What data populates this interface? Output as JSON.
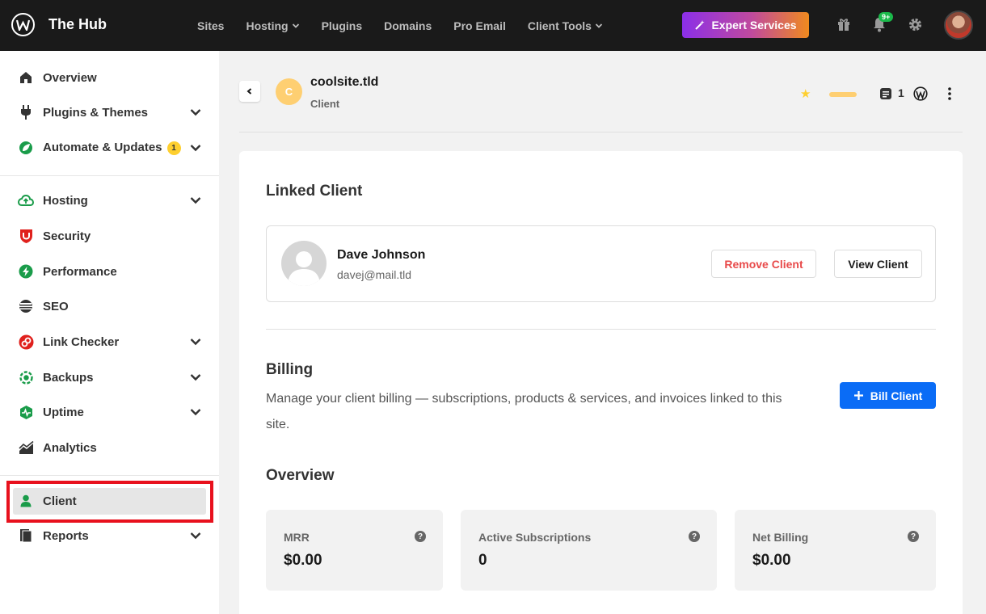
{
  "header": {
    "brand": "The Hub",
    "nav": [
      {
        "label": "Sites",
        "has_dropdown": false
      },
      {
        "label": "Hosting",
        "has_dropdown": true
      },
      {
        "label": "Plugins",
        "has_dropdown": false
      },
      {
        "label": "Domains",
        "has_dropdown": false
      },
      {
        "label": "Pro Email",
        "has_dropdown": false
      },
      {
        "label": "Client Tools",
        "has_dropdown": true
      }
    ],
    "expert_label": "Expert Services",
    "notification_badge": "9+"
  },
  "sidebar": {
    "group1": [
      {
        "label": "Overview",
        "icon": "home-icon"
      },
      {
        "label": "Plugins & Themes",
        "icon": "plug-icon"
      },
      {
        "label": "Automate & Updates",
        "icon": "automate-icon",
        "badge": "1"
      }
    ],
    "group2": [
      {
        "label": "Hosting",
        "icon": "cloud-icon"
      },
      {
        "label": "Security",
        "icon": "shield-icon"
      },
      {
        "label": "Performance",
        "icon": "bolt-icon"
      },
      {
        "label": "SEO",
        "icon": "seo-icon"
      },
      {
        "label": "Link Checker",
        "icon": "link-icon"
      },
      {
        "label": "Backups",
        "icon": "backup-icon"
      },
      {
        "label": "Uptime",
        "icon": "uptime-icon"
      },
      {
        "label": "Analytics",
        "icon": "analytics-icon"
      }
    ],
    "group3": [
      {
        "label": "Client",
        "icon": "user-icon"
      },
      {
        "label": "Reports",
        "icon": "report-icon"
      }
    ]
  },
  "site": {
    "initial": "C",
    "name": "coolsite.tld",
    "subtitle": "Client",
    "post_count": "1"
  },
  "linked_client": {
    "heading": "Linked Client",
    "name": "Dave Johnson",
    "email": "davej@mail.tld",
    "remove_label": "Remove Client",
    "view_label": "View Client"
  },
  "billing": {
    "heading": "Billing",
    "description": "Manage your client billing — subscriptions, products & services, and invoices linked to this site.",
    "bill_label": "Bill Client"
  },
  "overview": {
    "heading": "Overview",
    "stats": [
      {
        "label": "MRR",
        "value": "$0.00"
      },
      {
        "label": "Active Subscriptions",
        "value": "0"
      },
      {
        "label": "Net Billing",
        "value": "$0.00"
      }
    ]
  },
  "colors": {
    "topbar": "#1a1a1a",
    "primary_blue": "#0a6cf6",
    "danger": "#e84a4a",
    "highlight_red": "#e8111d",
    "accent_yellow": "#fecf2f"
  }
}
